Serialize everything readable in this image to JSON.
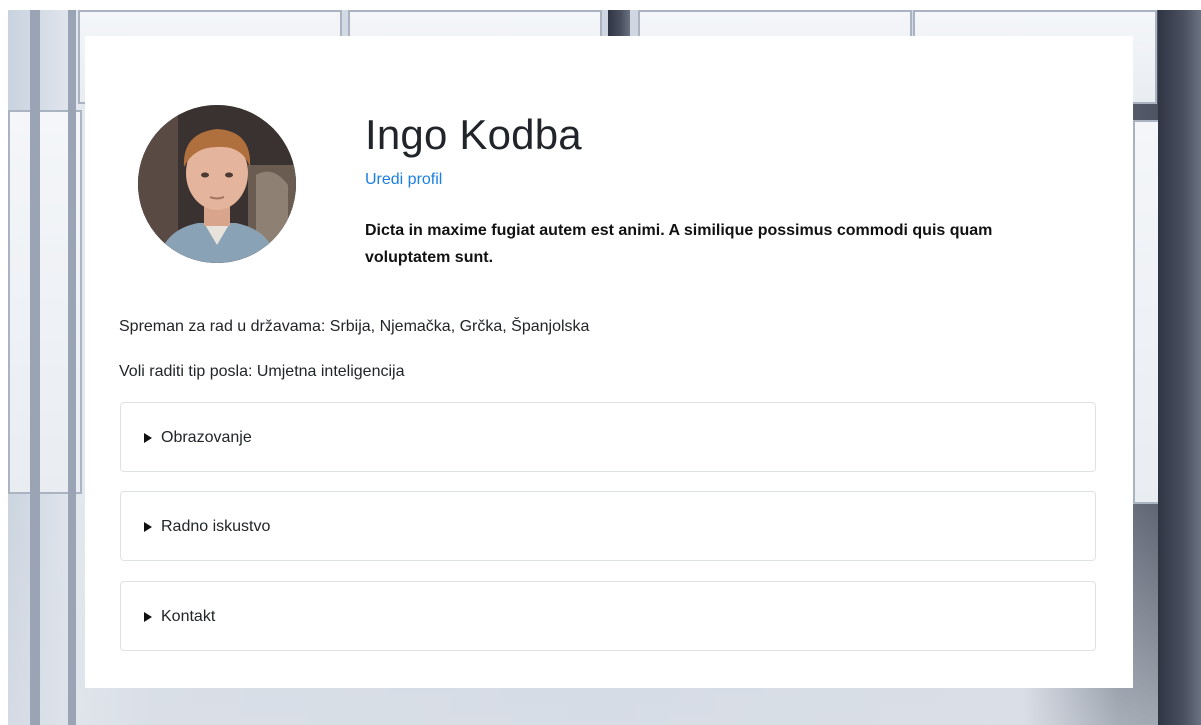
{
  "profile": {
    "name": "Ingo Kodba",
    "edit_link": "Uredi profil",
    "bio": "Dicta in maxime fugiat autem est animi. A similique possimus commodi quis quam voluptatem sunt.",
    "countries_text": "Spreman za rad u državama: Srbija, Njemačka, Grčka, Španjolska",
    "job_type_text": "Voli raditi tip posla: Umjetna inteligencija"
  },
  "sections": {
    "education": "Obrazovanje",
    "experience": "Radno iskustvo",
    "contact": "Kontakt"
  },
  "colors": {
    "link": "#1a7fe0",
    "border": "#dee2e6",
    "text": "#212529"
  }
}
